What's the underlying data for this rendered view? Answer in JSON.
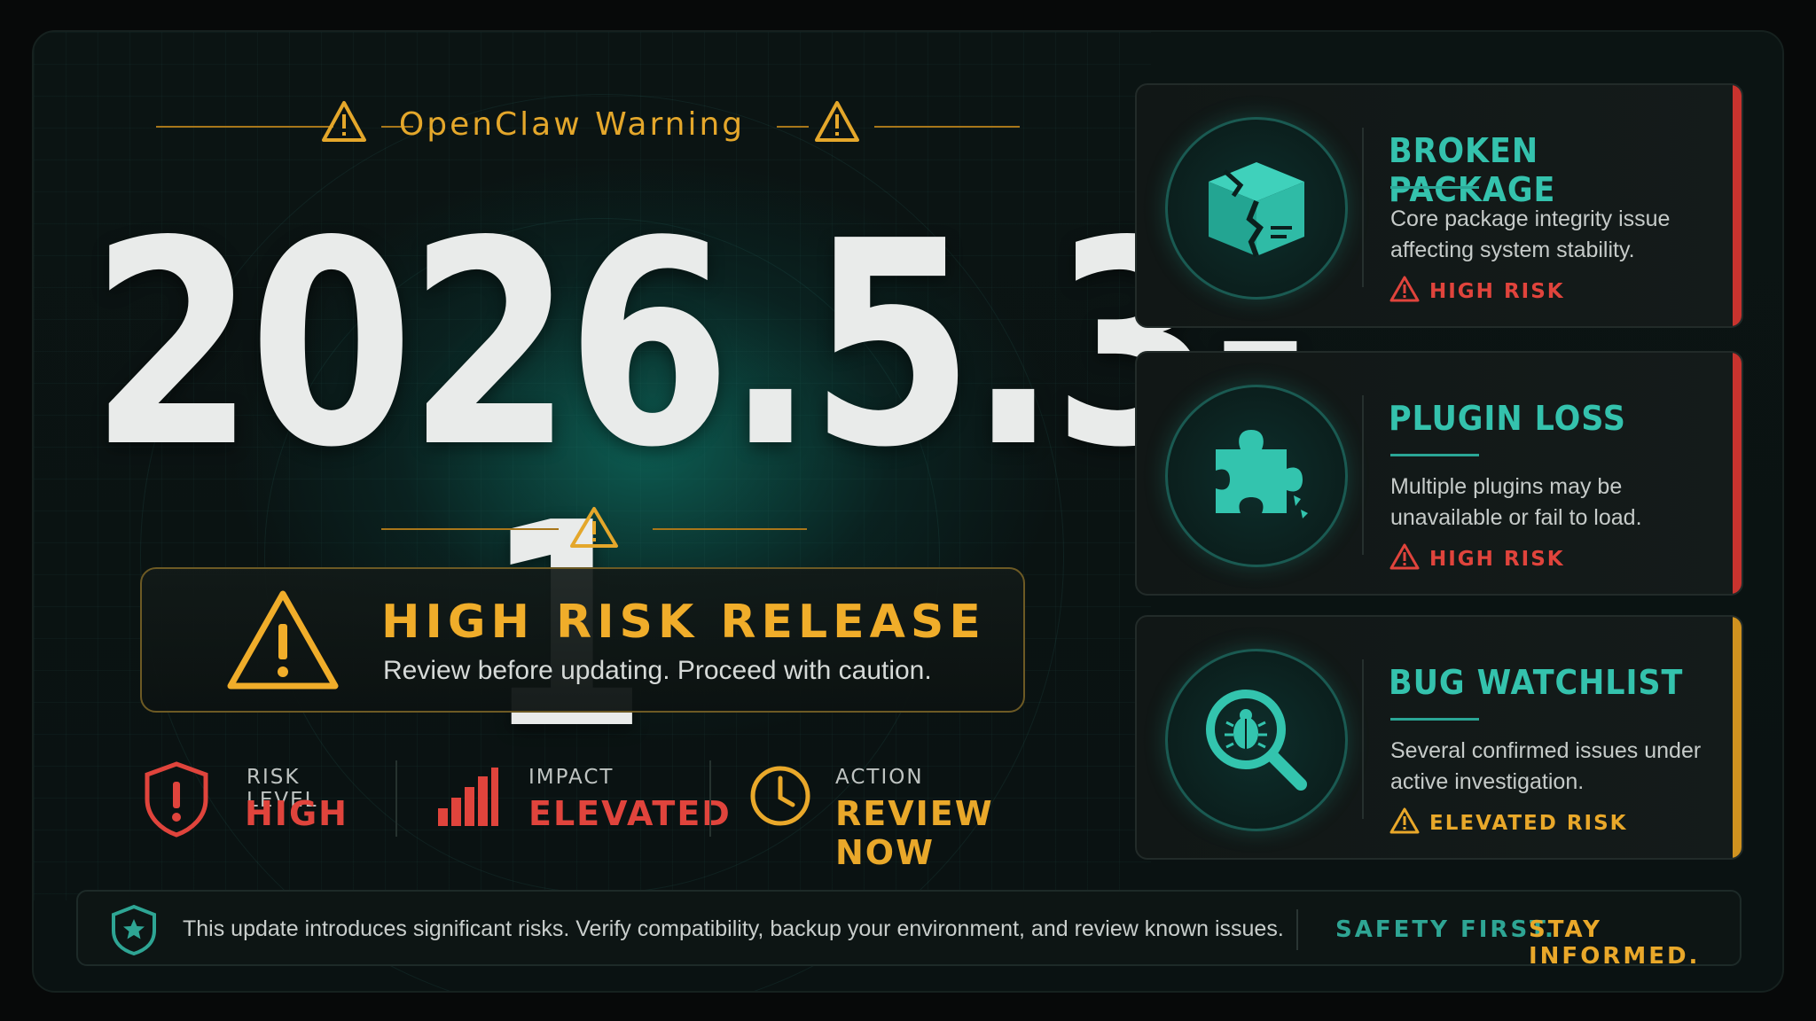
{
  "header": {
    "title": "OpenClaw Warning"
  },
  "version": "2026.5.3-1",
  "alert": {
    "title": "HIGH RISK RELEASE",
    "subtitle": "Review before updating. Proceed with caution."
  },
  "stats": [
    {
      "label": "RISK LEVEL",
      "value": "HIGH",
      "icon": "shield-exclamation-icon",
      "color": "#e0443c"
    },
    {
      "label": "IMPACT",
      "value": "ELEVATED",
      "icon": "bar-chart-icon",
      "color": "#e0443c"
    },
    {
      "label": "ACTION",
      "value": "REVIEW NOW",
      "icon": "clock-icon",
      "color": "#e9a82a"
    }
  ],
  "cards": [
    {
      "title": "BROKEN PACKAGE",
      "description": "Core package integrity issue affecting system stability.",
      "risk": "HIGH RISK",
      "risk_color": "#e0443c",
      "icon": "broken-box-icon"
    },
    {
      "title": "PLUGIN LOSS",
      "description": "Multiple plugins may be unavailable or fail to load.",
      "risk": "HIGH RISK",
      "risk_color": "#e0443c",
      "icon": "puzzle-piece-icon"
    },
    {
      "title": "BUG WATCHLIST",
      "description": "Several confirmed issues under active investigation.",
      "risk": "ELEVATED RISK",
      "risk_color": "#e9a82a",
      "icon": "bug-magnifier-icon"
    }
  ],
  "footer": {
    "message": "This update introduces significant risks. Verify compatibility, backup your environment, and review known issues.",
    "tag1": "SAFETY FIRST.",
    "tag2": "STAY INFORMED."
  },
  "colors": {
    "accent_teal": "#34c2ad",
    "warning_amber": "#e9a82a",
    "danger_red": "#e0443c"
  }
}
